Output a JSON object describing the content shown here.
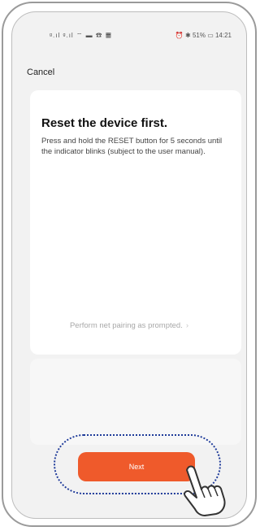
{
  "status": {
    "left_icons": "ᵍ.ıl ᵍ.ıl ⌔ ▬ ☎ ▦",
    "right": "⏰ ✱ 51% ▭ 14:21"
  },
  "header": {
    "cancel_label": "Cancel"
  },
  "content": {
    "title": "Reset the device first.",
    "description": "Press and hold the RESET button for 5 seconds until the indicator blinks (subject to the user manual).",
    "pairing_link": "Perform net pairing as prompted."
  },
  "footer": {
    "next_label": "Next"
  },
  "colors": {
    "accent": "#ef5a2b",
    "highlight_ring": "#1f3b9a"
  }
}
